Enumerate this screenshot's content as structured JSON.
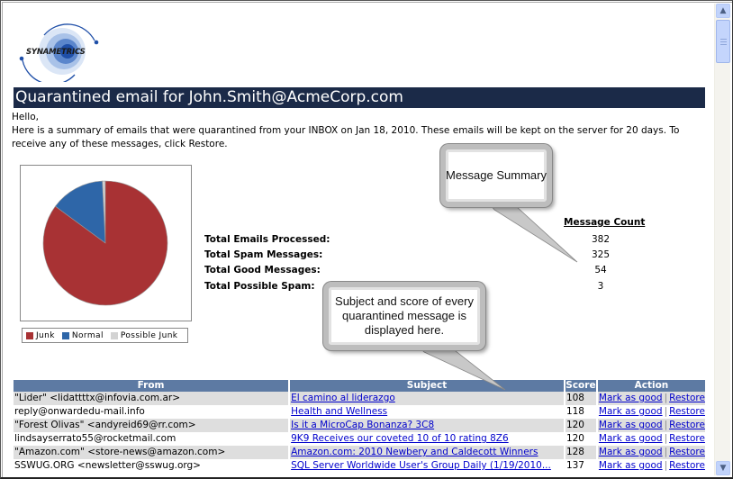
{
  "brand": {
    "logo_text": "SYNAMETRICS"
  },
  "header": {
    "title": "Quarantined email for John.Smith@AcmeCorp.com"
  },
  "intro": {
    "greeting": "Hello,",
    "body": "Here is a summary of emails that were quarantined from your INBOX on Jan 18, 2010. These emails will be kept on the server for 20 days. To receive any of these messages, click Restore."
  },
  "colors": {
    "junk": "#a83234",
    "normal": "#2e66a8",
    "possible_junk": "#d3d3d3",
    "title_bar": "#1b2a48",
    "table_header": "#5d7aa3"
  },
  "chart_data": {
    "type": "pie",
    "title": "",
    "legend_position": "bottom",
    "categories": [
      "Junk",
      "Normal",
      "Possible Junk"
    ],
    "values": [
      325,
      54,
      3
    ],
    "colors": [
      "#a83234",
      "#2e66a8",
      "#d3d3d3"
    ]
  },
  "summary": {
    "column_header": "Message Count",
    "rows": [
      {
        "label": "Total Emails Processed:",
        "value": "382"
      },
      {
        "label": "Total Spam Messages:",
        "value": "325"
      },
      {
        "label": "Total Good Messages:",
        "value": "54"
      },
      {
        "label": "Total Possible Spam:",
        "value": "3"
      }
    ]
  },
  "callouts": {
    "summary": "Message Summary",
    "table": "Subject and score of every quarantined message is displayed here."
  },
  "table": {
    "headers": {
      "from": "From",
      "subject": "Subject",
      "score": "Score",
      "action": "Action"
    },
    "action_labels": {
      "mark_good": "Mark as good",
      "separator": "|",
      "restore": "Restore"
    },
    "rows": [
      {
        "from": "\"Lider\" <lidattttx@infovia.com.ar>",
        "subject": "El camino al liderazgo",
        "score": "108"
      },
      {
        "from": "reply@onwardedu-mail.info",
        "subject": "Health and Wellness",
        "score": "118"
      },
      {
        "from": "\"Forest Olivas\" <andyreid69@rr.com>",
        "subject": "Is it a MicroCap Bonanza? 3C8",
        "score": "120"
      },
      {
        "from": "lindsayserrato55@rocketmail.com",
        "subject": "9K9 Receives our coveted 10 of 10 rating 8Z6",
        "score": "120"
      },
      {
        "from": "\"Amazon.com\" <store-news@amazon.com>",
        "subject": "Amazon.com: 2010 Newbery and Caldecott Winners",
        "score": "128"
      },
      {
        "from": "SSWUG.ORG <newsletter@sswug.org>",
        "subject": "SQL Server Worldwide User's Group Daily (1/19/2010...",
        "score": "137"
      }
    ]
  }
}
